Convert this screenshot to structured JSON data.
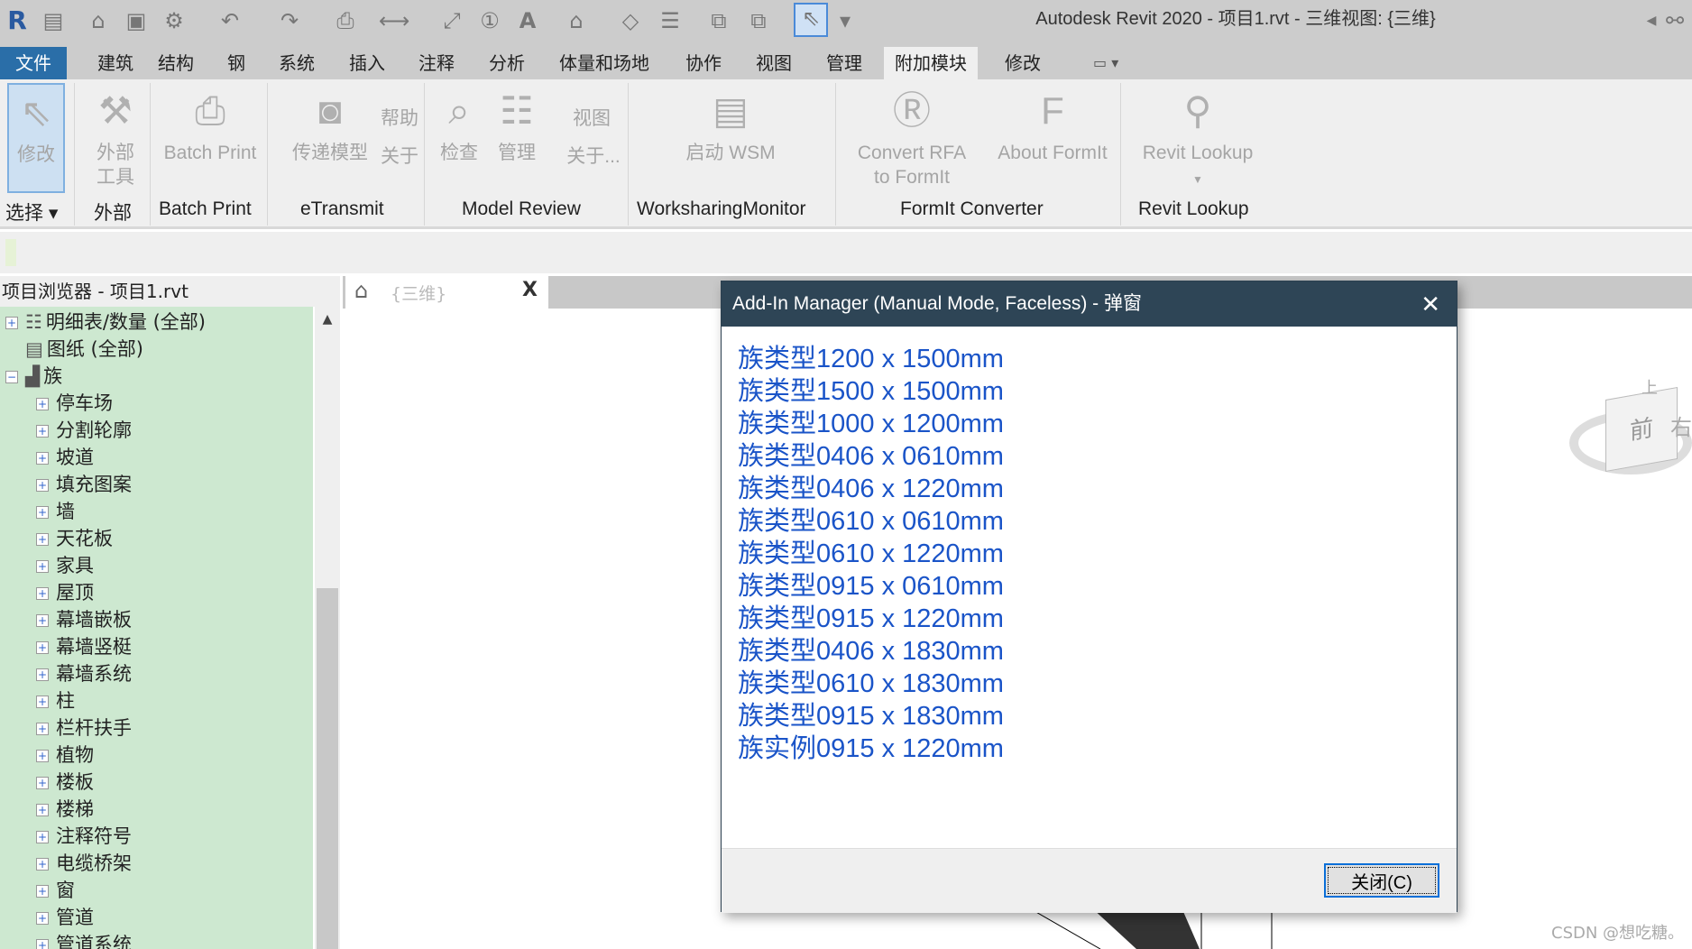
{
  "window": {
    "title": "Autodesk Revit 2020 - 项目1.rvt - 三维视图: {三维}",
    "logo": "R"
  },
  "tabs": [
    "文件",
    "建筑",
    "结构",
    "钢",
    "系统",
    "插入",
    "注释",
    "分析",
    "体量和场地",
    "协作",
    "视图",
    "管理",
    "附加模块",
    "修改"
  ],
  "active_tab": "附加模块",
  "ribbon": {
    "buttons": [
      {
        "label": "修改",
        "icon": "cursor-icon"
      },
      {
        "label": "外部\n工具",
        "icon": "tools-icon"
      },
      {
        "label": "Batch Print",
        "icon": "printer-icon"
      },
      {
        "label": "传递模型",
        "icon": "etransmit-icon"
      },
      {
        "label": "帮助",
        "icon": ""
      },
      {
        "label": "关于",
        "icon": ""
      },
      {
        "label": "检查",
        "icon": "inspect-icon"
      },
      {
        "label": "管理",
        "icon": "checklist-icon"
      },
      {
        "label": "视图",
        "icon": ""
      },
      {
        "label": "关于...",
        "icon": ""
      },
      {
        "label": "启动 WSM",
        "icon": "wsm-icon"
      },
      {
        "label": "Convert RFA\nto FormIt",
        "icon": "rfa-icon"
      },
      {
        "label": "About FormIt",
        "icon": "formit-icon"
      },
      {
        "label": "Revit Lookup",
        "icon": "lookup-icon"
      }
    ],
    "groups": [
      "选择 ▾",
      "外部",
      "Batch Print",
      "eTransmit",
      "Model Review",
      "WorksharingMonitor",
      "FormIt Converter",
      "Revit Lookup"
    ]
  },
  "browser": {
    "title": "项目浏览器 - 项目1.rvt",
    "roots": [
      "明细表/数量 (全部)",
      "图纸 (全部)",
      "族"
    ],
    "children": [
      "停车场",
      "分割轮廓",
      "坡道",
      "填充图案",
      "墙",
      "天花板",
      "家具",
      "屋顶",
      "幕墙嵌板",
      "幕墙竖梃",
      "幕墙系统",
      "柱",
      "栏杆扶手",
      "植物",
      "楼板",
      "楼梯",
      "注释符号",
      "电缆桥架",
      "窗",
      "管道",
      "管道系统"
    ]
  },
  "view_tab": {
    "label": "{三维}",
    "close": "X"
  },
  "viewcube": {
    "top": "上",
    "front": "前",
    "right": "右"
  },
  "dialog": {
    "title": "Add-In Manager (Manual Mode, Faceless) - 弹窗",
    "items": [
      "族类型1200 x 1500mm",
      "族类型1500 x 1500mm",
      "族类型1000 x 1200mm",
      "族类型0406 x 0610mm",
      "族类型0406 x 1220mm",
      "族类型0610 x 0610mm",
      "族类型0610 x 1220mm",
      "族类型0915 x 0610mm",
      "族类型0915 x 1220mm",
      "族类型0406 x 1830mm",
      "族类型0610 x 1830mm",
      "族类型0915 x 1830mm",
      "族实例0915 x 1220mm"
    ],
    "close_button": "关闭(C)"
  },
  "watermark": "CSDN @想吃糖。"
}
